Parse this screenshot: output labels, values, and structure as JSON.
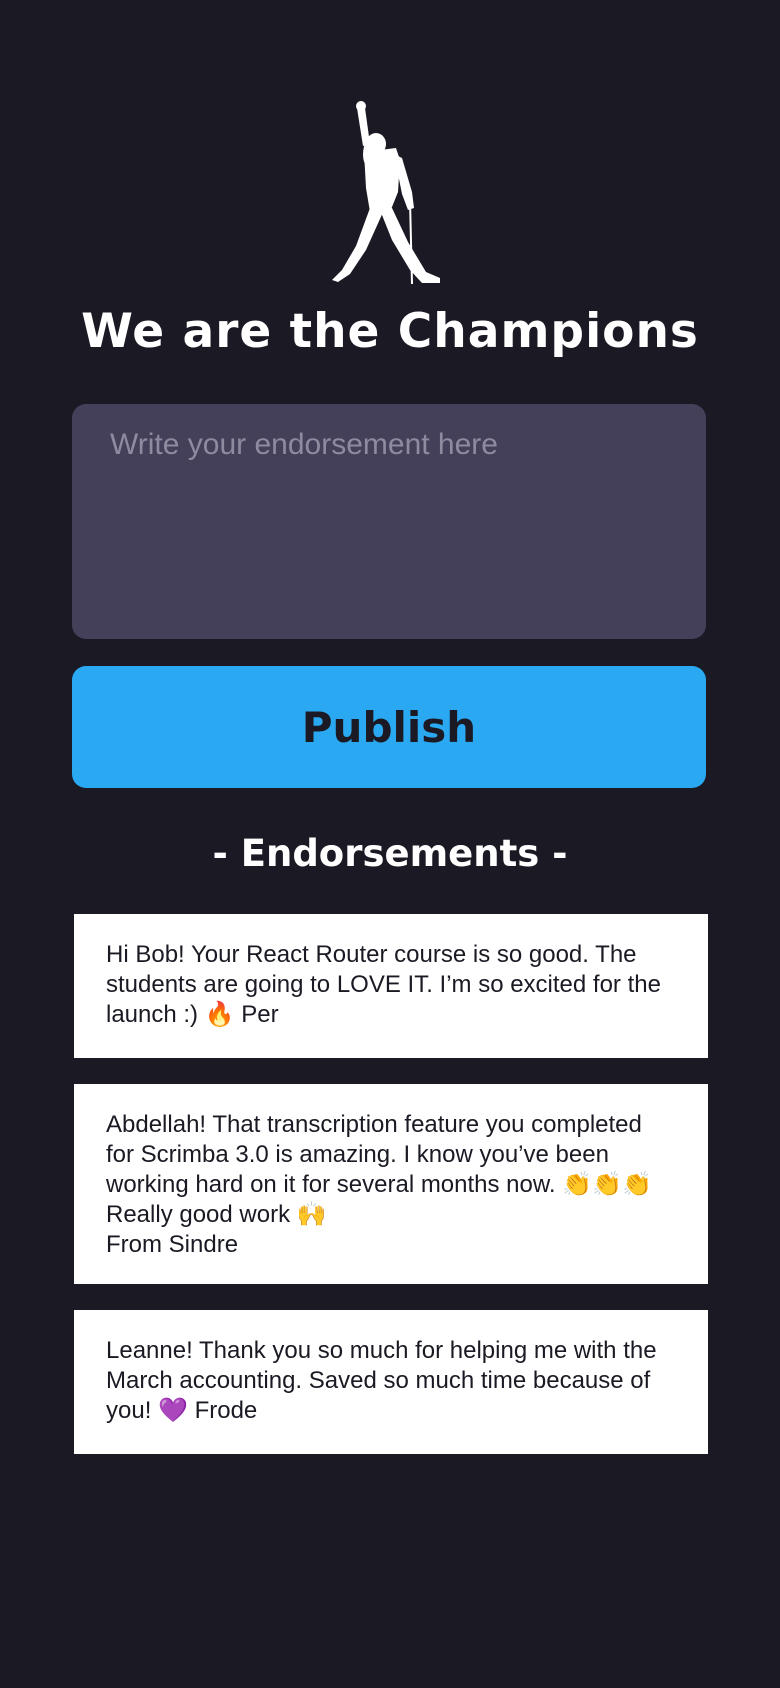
{
  "app": {
    "logo_icon": "freddie-mercury-silhouette-icon",
    "title": "We are the Champions"
  },
  "form": {
    "placeholder": "Write your endorsement here",
    "publish_label": "Publish"
  },
  "endorsements": {
    "heading": "- Endorsements -",
    "items": [
      {
        "text": "Hi Bob! Your React Router course is so good. The students are going to LOVE IT. I’m so excited for the launch :) 🔥 Per"
      },
      {
        "text": "Abdellah! That transcription feature you completed for Scrimba 3.0 is amazing. I know you’ve been working hard on it for several months now. 👏👏👏 Really good work 🙌\nFrom Sindre"
      },
      {
        "text": "Leanne! Thank you so much for helping me with the March accounting. Saved so much time because of you! 💜 Frode"
      }
    ]
  },
  "colors": {
    "background": "#1b1a24",
    "input_background": "#444059",
    "accent": "#2aa9f2",
    "card_background": "#ffffff"
  }
}
